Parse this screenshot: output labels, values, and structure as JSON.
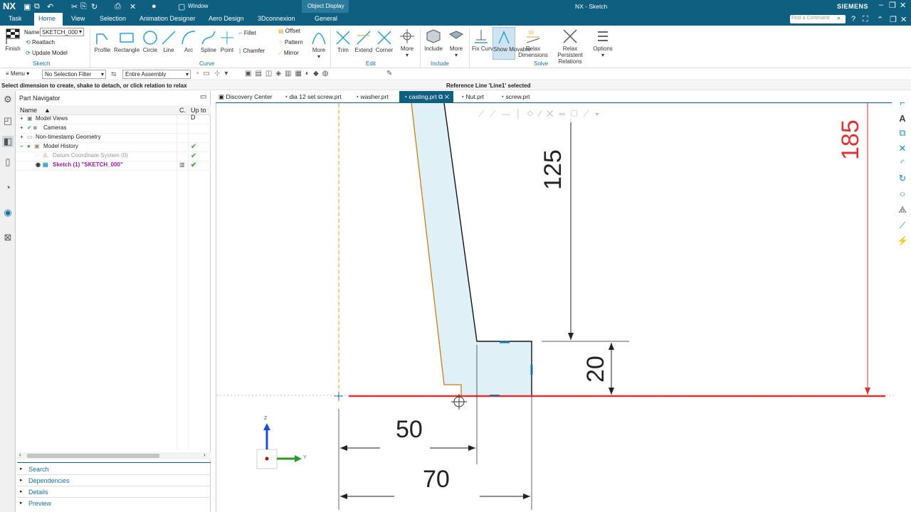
{
  "app": {
    "logo": "NX",
    "window_title": "NX - Sketch",
    "brand": "SIEMENS",
    "window_menu": "Window",
    "context_tab": "Object Display",
    "search_placeholder": "Find a Command"
  },
  "menu_tabs": [
    "Task",
    "Home",
    "View",
    "Selection",
    "Animation Designer",
    "Aero Design",
    "3Dconnexion",
    "General"
  ],
  "ribbon": {
    "finish": "Finish",
    "name_label": "Name",
    "name_value": "SKETCH_000",
    "reattach": "Reattach",
    "update_model": "Update Model",
    "curve_tools": [
      "Profile",
      "Rectangle",
      "Circle",
      "Line",
      "Arc",
      "Spline",
      "Point"
    ],
    "fillet": "Fillet",
    "chamfer": "Chamfer",
    "offset": "Offset",
    "pattern": "Pattern",
    "mirror": "Mirror",
    "more": "More",
    "edit_tools": [
      "Trim",
      "Extend",
      "Corner"
    ],
    "include": "Include",
    "fix_curve": "Fix Curve",
    "show_movable": "Show Movable",
    "relax_dimensions": "Relax Dimensions",
    "relax_persistent": "Relax Persistent Relations",
    "options": "Options",
    "groups": [
      "Sketch",
      "Curve",
      "Edit",
      "Include",
      "Solve"
    ]
  },
  "toolbar2": {
    "menu": "Menu",
    "selection_filter": "No Selection Filter",
    "scope": "Entire Assembly"
  },
  "cue_line": "Select dimension to create, shake to detach, or click relation to relax",
  "status_line": "Reference Line 'Line1' selected",
  "navigator": {
    "title": "Part Navigator",
    "columns": [
      "Name",
      "C.",
      "Up to D"
    ],
    "rows": [
      {
        "label": "Model Views"
      },
      {
        "label": "Cameras"
      },
      {
        "label": "Non-timestamp Geometry"
      },
      {
        "label": "Model History"
      },
      {
        "label": "Datum Coordinate System (0)"
      },
      {
        "label": "Sketch (1) \"SKETCH_000\""
      }
    ],
    "panels": [
      "Search",
      "Dependencies",
      "Details",
      "Preview"
    ]
  },
  "doc_tabs": [
    "Discovery Center",
    "dia 12 set screw.prt",
    "washer.prt",
    "casting.prt",
    "Nut.prt",
    "screw.prt"
  ],
  "active_doc": "casting.prt",
  "dimensions": {
    "d125": "125",
    "d185": "185",
    "d20": "20",
    "d50": "50",
    "d70": "70"
  },
  "triad": {
    "z": "Z",
    "y": "Y"
  },
  "colors": {
    "header": "#0f5f80",
    "sketch_fill": "#dff0f6",
    "dim_red": "#e03232",
    "accent_blue": "#1a6fa3"
  }
}
